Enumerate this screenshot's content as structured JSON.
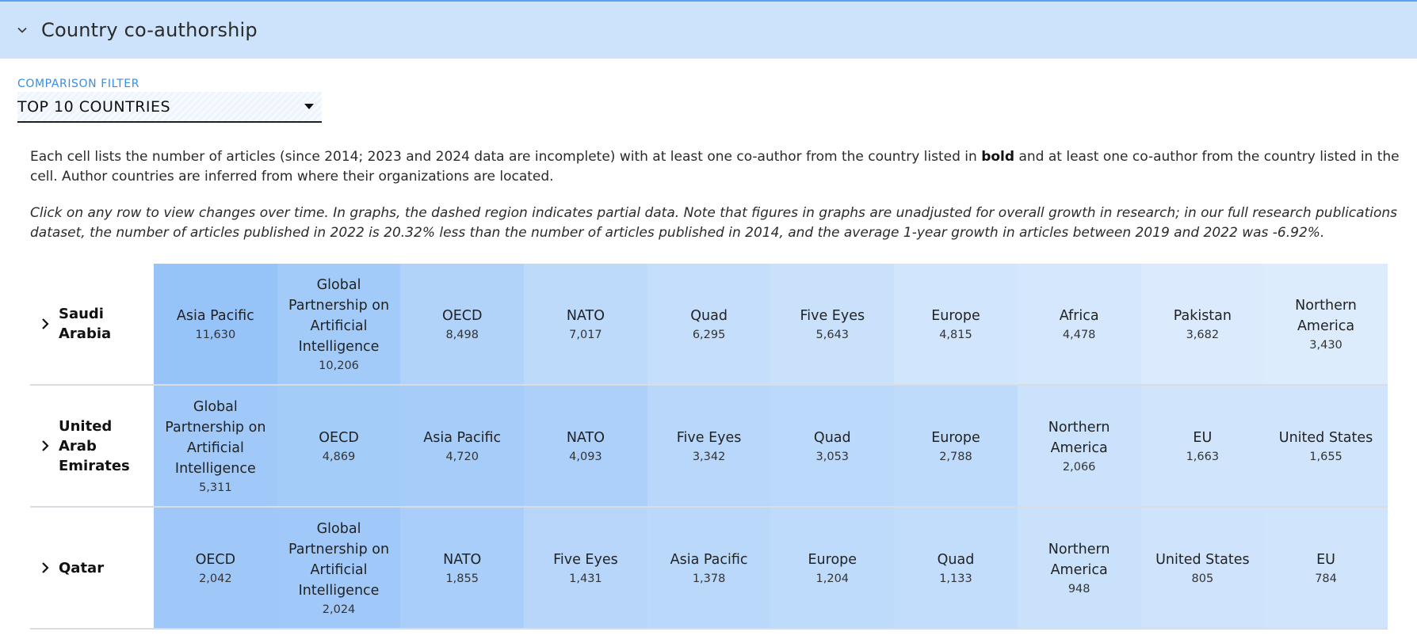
{
  "section": {
    "title": "Country co-authorship"
  },
  "filter": {
    "label": "COMPARISON FILTER",
    "value": "TOP 10 COUNTRIES"
  },
  "description": {
    "p1_before": "Each cell lists the number of articles (since 2014; 2023 and 2024 data are incomplete) with at least one co-author from the country listed in ",
    "p1_bold": "bold",
    "p1_after": " and at least one co-author from the country listed in the cell. Author countries are inferred from where their organizations are located.",
    "p2": "Click on any row to view changes over time. In graphs, the dashed region indicates partial data. Note that figures in graphs are unadjusted for overall growth in research; in our full research publications dataset, the number of articles published in 2022 is 20.32% less than the number of articles published in 2014, and the average 1-year growth in articles between 2019 and 2022 was -6.92%."
  },
  "colors": {
    "header_bg": "#cde3fb",
    "accent": "#3a8de0"
  },
  "rows": [
    {
      "country": "Saudi Arabia",
      "cells": [
        {
          "name": "Asia Pacific",
          "value": "11,630",
          "color": "#97c4f8"
        },
        {
          "name": "Global Partnership on Artificial Intelligence",
          "value": "10,206",
          "color": "#a3cbf9"
        },
        {
          "name": "OECD",
          "value": "8,498",
          "color": "#b1d3fa"
        },
        {
          "name": "NATO",
          "value": "7,017",
          "color": "#bddafb"
        },
        {
          "name": "Quad",
          "value": "6,295",
          "color": "#c4defb"
        },
        {
          "name": "Five Eyes",
          "value": "5,643",
          "color": "#c9e1fb"
        },
        {
          "name": "Europe",
          "value": "4,815",
          "color": "#d1e5fc"
        },
        {
          "name": "Africa",
          "value": "4,478",
          "color": "#d4e7fc"
        },
        {
          "name": "Pakistan",
          "value": "3,682",
          "color": "#dbebfd"
        },
        {
          "name": "Northern America",
          "value": "3,430",
          "color": "#ddecfd"
        }
      ]
    },
    {
      "country": "United Arab Emirates",
      "cells": [
        {
          "name": "Global Partnership on Artificial Intelligence",
          "value": "5,311",
          "color": "#a0c9f9"
        },
        {
          "name": "OECD",
          "value": "4,869",
          "color": "#a4ccf9"
        },
        {
          "name": "Asia Pacific",
          "value": "4,720",
          "color": "#a6cdf9"
        },
        {
          "name": "NATO",
          "value": "4,093",
          "color": "#acd0fa"
        },
        {
          "name": "Five Eyes",
          "value": "3,342",
          "color": "#b8d7fa"
        },
        {
          "name": "Quad",
          "value": "3,053",
          "color": "#bbd9fb"
        },
        {
          "name": "Europe",
          "value": "2,788",
          "color": "#bfdbfb"
        },
        {
          "name": "Northern America",
          "value": "2,066",
          "color": "#cae2fb"
        },
        {
          "name": "EU",
          "value": "1,663",
          "color": "#d0e5fc"
        },
        {
          "name": "United States",
          "value": "1,655",
          "color": "#d0e5fc"
        }
      ]
    },
    {
      "country": "Qatar",
      "cells": [
        {
          "name": "OECD",
          "value": "2,042",
          "color": "#9fc8f9"
        },
        {
          "name": "Global Partnership on Artificial Intelligence",
          "value": "2,024",
          "color": "#a0c9f9"
        },
        {
          "name": "NATO",
          "value": "1,855",
          "color": "#a8cef9"
        },
        {
          "name": "Five Eyes",
          "value": "1,431",
          "color": "#b7d6fa"
        },
        {
          "name": "Asia Pacific",
          "value": "1,378",
          "color": "#b9d8fa"
        },
        {
          "name": "Europe",
          "value": "1,204",
          "color": "#bfdbfb"
        },
        {
          "name": "Quad",
          "value": "1,133",
          "color": "#c2ddfb"
        },
        {
          "name": "Northern America",
          "value": "948",
          "color": "#c9e1fb"
        },
        {
          "name": "United States",
          "value": "805",
          "color": "#cfe4fc"
        },
        {
          "name": "EU",
          "value": "784",
          "color": "#d0e5fc"
        }
      ]
    }
  ]
}
